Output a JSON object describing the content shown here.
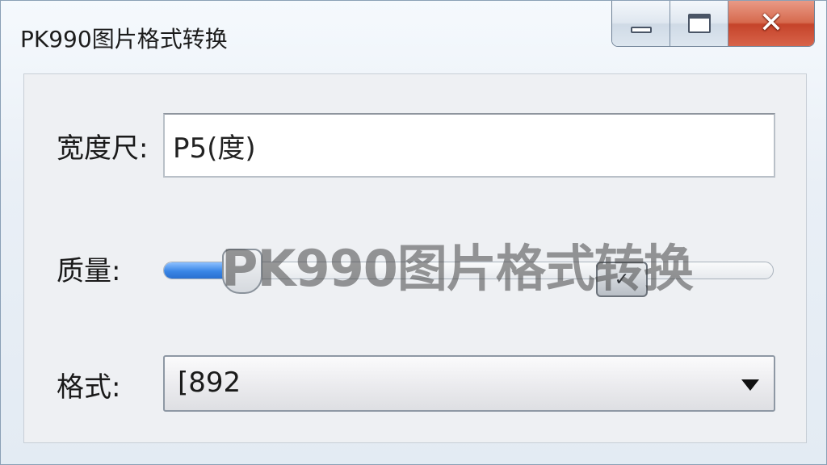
{
  "window": {
    "title": "PK990图片格式转换",
    "caption": {
      "minimize_icon": "minimize-icon",
      "maximize_icon": "maximize-icon",
      "close_label": "✕"
    }
  },
  "form": {
    "width_label": "宽度尺:",
    "width_value": "P5(度)",
    "quality_label": "质量:",
    "quality_value_percent": 13,
    "slider_end_glyph": "✓",
    "format_label": "格式:",
    "format_value": "[892",
    "watermark": "PK990图片格式转换"
  },
  "colors": {
    "slider_fill": "#3a86e6",
    "close_button": "#d05a3f"
  }
}
